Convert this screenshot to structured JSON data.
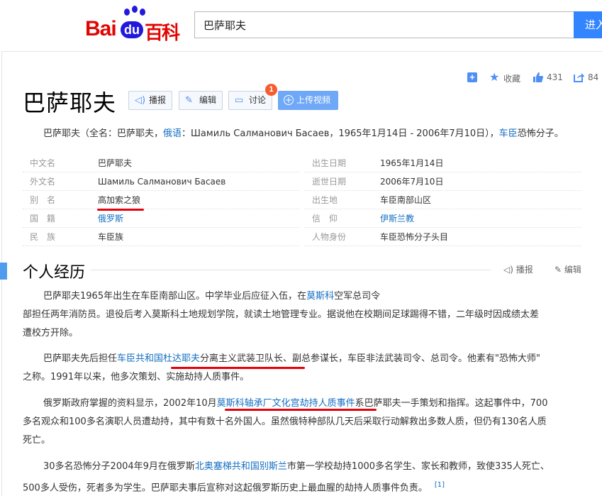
{
  "header": {
    "logo_bai": "Bai",
    "logo_du": "du",
    "logo_baike": "百科",
    "search_value": "巴萨耶夫",
    "search_button": "进入"
  },
  "actions": {
    "favorite": "收藏",
    "likes": "431",
    "shares": "84"
  },
  "title": "巴萨耶夫",
  "title_buttons": {
    "report": "播报",
    "edit": "编辑",
    "discuss": "讨论",
    "discuss_badge": "1",
    "upload": "上传视频"
  },
  "summary": {
    "part1": "巴萨耶夫（全名：巴萨耶夫，",
    "link1": "俄语",
    "part2": "：Шамиль Салманович Басаев，1965年1月14日 - 2006年7月10日），",
    "link2": "车臣",
    "part3": "恐怖分子。"
  },
  "basic_info": {
    "left": [
      {
        "key": "中文名",
        "value": "巴萨耶夫"
      },
      {
        "key": "外文名",
        "value": "Шамиль Салманович Басаев"
      },
      {
        "key": "别　名",
        "value": "高加索之狼"
      },
      {
        "key": "国　籍",
        "value": "俄罗斯"
      },
      {
        "key": "民　族",
        "value": "车臣族"
      }
    ],
    "right": [
      {
        "key": "出生日期",
        "value": "1965年1月14日"
      },
      {
        "key": "逝世日期",
        "value": "2006年7月10日"
      },
      {
        "key": "出生地",
        "value": "车臣南部山区"
      },
      {
        "key": "信　仰",
        "value": "伊斯兰教"
      },
      {
        "key": "人物身份",
        "value": "车臣恐怖分子头目"
      }
    ]
  },
  "section": {
    "title": "个人经历",
    "report": "播报",
    "edit": "编辑"
  },
  "paragraphs": {
    "p1_l1a": "巴萨耶夫1965年出生在车臣南部山区。中学毕业后应征入伍，在",
    "p1_l1_link": "莫斯科",
    "p1_l1b": "空军总司令",
    "p1_l2": "部担任两年消防员。退役后考入莫斯科土地规划学院，就读土地管理专业。据说他在校期间足球踢得不错，二年级时因成绩太差",
    "p1_l3": "遭校方开除。",
    "p2_l1a": "巴萨耶夫先后担任",
    "p2_l1_link": "车臣共和国杜达耶夫",
    "p2_l1b": "分离主义武装卫队长、副总参谋长，车臣非法武装司令、总司令。他素有\"恐怖大师\"",
    "p2_l2": "之称。1991年以来，他多次策划、实施劫持人质事件。",
    "p3_l1a": "俄罗斯政府掌握的资料显示，2002年10月",
    "p3_l1_link": "莫斯科轴承厂文化宫劫持人质事件",
    "p3_l1b": "系巴萨耶夫一手策划和指挥。这起事件中，700",
    "p3_l2": "多名观众和100多名演职人员遭劫持，其中有数十名外国人。虽然俄特种部队几天后采取行动解救出多数人质，但仍有130名人质",
    "p3_l3": "死亡。",
    "p4_l1a": "30多名恐怖分子2004年9月在俄罗斯",
    "p4_l1_link": "北奥塞梯共和国别斯兰",
    "p4_l1b": "市第一学校劫持1000多名学生、家长和教师，致使335人死亡、",
    "p4_l2": "500多人受伤，死者多为学生。巴萨耶夫事后宣称对这起俄罗斯历史上最血腥的劫持人质事件负责。",
    "p4_ref": "[1]"
  }
}
